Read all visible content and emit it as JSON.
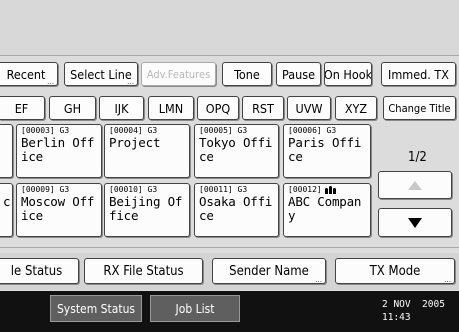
{
  "toolbar": {
    "recent": "Recent",
    "select_line": "Select Line",
    "adv_features": "Adv.Features",
    "tone": "Tone",
    "pause": "Pause",
    "on_hook": "On Hook",
    "immed_tx": "Immed. TX"
  },
  "index_tabs": [
    "EF",
    "GH",
    "IJK",
    "LMN",
    "OPQ",
    "RST",
    "UVW",
    "XYZ"
  ],
  "change_title": "Change Title",
  "destinations": [
    {
      "code": "[00003] G3",
      "line1": "Berlin Off",
      "line2": "ice",
      "group": false
    },
    {
      "code": "[00004] G3",
      "line1": "Project",
      "line2": "",
      "group": false
    },
    {
      "code": "[00005] G3",
      "line1": "Tokyo Offi",
      "line2": "ce",
      "group": false
    },
    {
      "code": "[00006] G3",
      "line1": "Paris Offi",
      "line2": "ce",
      "group": false
    },
    {
      "code": "[00009] G3",
      "line1": "Moscow Off",
      "line2": "ice",
      "group": false
    },
    {
      "code": "[00010] G3",
      "line1": "Beijing Of",
      "line2": "fice",
      "group": false
    },
    {
      "code": "[00011] G3",
      "line1": "Osaka Offi",
      "line2": "ce",
      "group": false
    },
    {
      "code": "[00012]",
      "line1": "ABC Compan",
      "line2": "y",
      "group": true
    }
  ],
  "left_fragment": "c",
  "pager": {
    "indicator": "1/2"
  },
  "file_tabs": {
    "file_status": "le Status",
    "rx_file_status": "RX File Status",
    "sender_name": "Sender Name",
    "tx_mode": "TX Mode"
  },
  "bottom": {
    "system_status": "System Status",
    "job_list": "Job List",
    "date_line": "2 NOV  2005",
    "time_line": "11:43"
  }
}
